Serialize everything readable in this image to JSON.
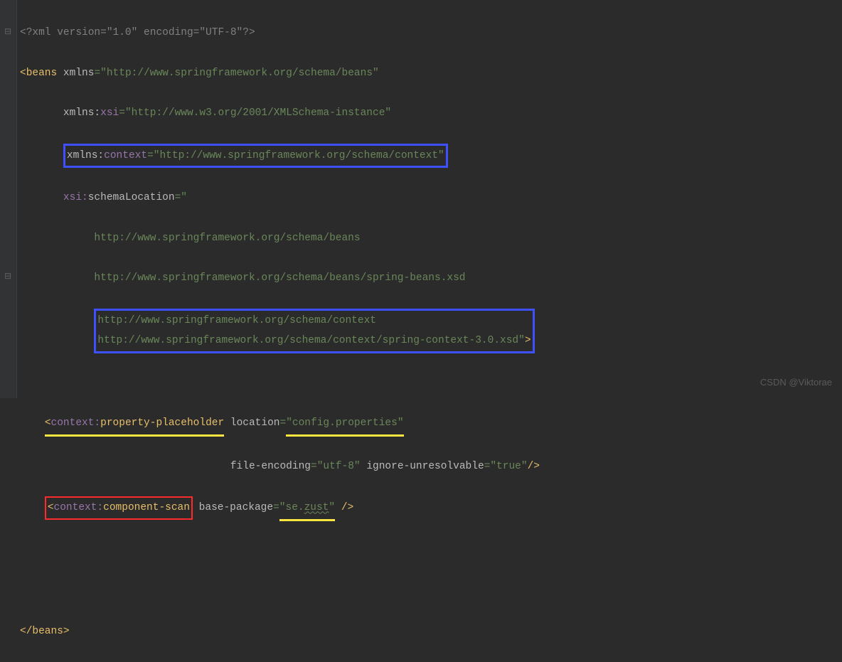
{
  "watermark": "CSDN @Viktorae",
  "pi": {
    "open": "<?",
    "name": "xml",
    "attrs": " version=\"1.0\" encoding=\"UTF-8\"",
    "close": "?>"
  },
  "beans_open": {
    "lt": "<",
    "name": "beans",
    "attrs": {
      "xmlns": {
        "key": "xmlns",
        "eq": "=",
        "q1": "\"",
        "val": "http://www.springframework.org/schema/beans",
        "q2": "\""
      },
      "xsi": {
        "key_ns": "xmlns:",
        "key_local": "xsi",
        "eq": "=",
        "q1": "\"",
        "val": "http://www.w3.org/2001/XMLSchema-instance",
        "q2": "\""
      },
      "ctx": {
        "key_ns": "xmlns:",
        "key_local": "context",
        "eq": "=",
        "q1": "\"",
        "val": "http://www.springframework.org/schema/context",
        "q2": "\""
      },
      "schemaLoc": {
        "key_ns": "xsi:",
        "key_local": "schemaLocation",
        "eq": "=",
        "q1": "\"",
        "l1": "            http://www.springframework.org/schema/beans",
        "l2": "            http://www.springframework.org/schema/beans/spring-beans.xsd",
        "l3": "            http://www.springframework.org/schema/context",
        "l4": "            http://www.springframework.org/schema/context/spring-context-3.0.xsd",
        "q2": "\"",
        "gt": ">"
      }
    }
  },
  "prop_placeholder": {
    "lt": "<",
    "ns": "context:",
    "local": "property-placeholder",
    "loc_key": "location",
    "loc_eq": "=",
    "loc_q1": "\"",
    "loc_val": "config.properties",
    "loc_q2": "\"",
    "fe_key": "file-encoding",
    "fe_eq": "=",
    "fe_q1": "\"",
    "fe_val": "utf-8",
    "fe_q2": "\"",
    "ig_key": "ignore-unresolvable",
    "ig_eq": "=",
    "ig_q1": "\"",
    "ig_val": "true",
    "ig_q2": "\"",
    "close": "/>"
  },
  "comp_scan": {
    "lt": "<",
    "ns": "context:",
    "local": "component-scan",
    "bp_key": "base-package",
    "bp_eq": "=",
    "bp_q1": "\"",
    "bp_val_a": "se.",
    "bp_val_b": "zust",
    "bp_q2": "\"",
    "close": " />"
  },
  "beans_close": {
    "lt": "</",
    "name": "beans",
    "gt": ">"
  },
  "fold": {
    "minus1": "⊟",
    "minus2": "⊟"
  }
}
